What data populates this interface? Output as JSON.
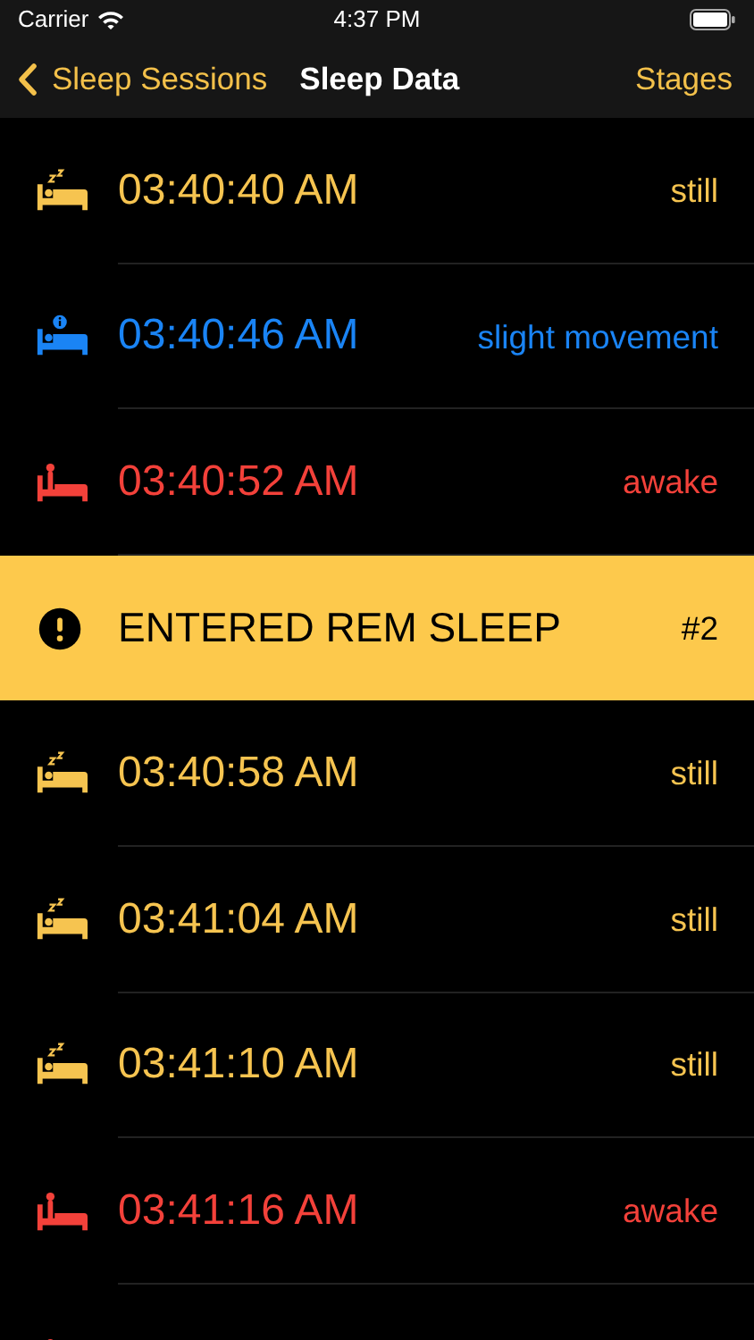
{
  "status_bar": {
    "carrier": "Carrier",
    "time": "4:37 PM"
  },
  "nav": {
    "back": "Sleep Sessions",
    "title": "Sleep Data",
    "action": "Stages"
  },
  "rows": [
    {
      "kind": "still",
      "time": "03:40:40 AM",
      "state": "still"
    },
    {
      "kind": "movement",
      "time": "03:40:46 AM",
      "state": "slight movement"
    },
    {
      "kind": "awake",
      "time": "03:40:52 AM",
      "state": "awake"
    },
    {
      "kind": "event",
      "time": "ENTERED REM SLEEP",
      "state": "#2"
    },
    {
      "kind": "still",
      "time": "03:40:58 AM",
      "state": "still"
    },
    {
      "kind": "still",
      "time": "03:41:04 AM",
      "state": "still"
    },
    {
      "kind": "still",
      "time": "03:41:10 AM",
      "state": "still"
    },
    {
      "kind": "awake",
      "time": "03:41:16 AM",
      "state": "awake"
    },
    {
      "kind": "awake"
    }
  ]
}
